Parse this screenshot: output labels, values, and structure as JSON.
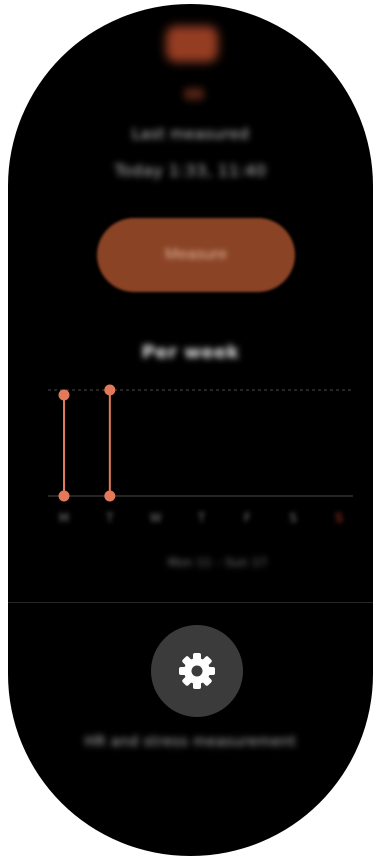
{
  "header": {
    "icon": "heart-rate-icon",
    "last_label": "Last measured",
    "last_time": "Today 1:33, 11:40"
  },
  "measure_button": {
    "label": "Measure"
  },
  "section": {
    "title": "Per week"
  },
  "chart_data": {
    "type": "range-bar",
    "categories": [
      "M",
      "T",
      "W",
      "T",
      "F",
      "S",
      "S"
    ],
    "series": [
      {
        "values": [
          [
            0,
            1.0
          ],
          [
            0,
            1.05
          ],
          null,
          null,
          null,
          null,
          null
        ]
      }
    ],
    "ylim": [
      0,
      1.05
    ],
    "grid": true,
    "accent": "#e2795a",
    "today_index": 6
  },
  "range_label": "Mon 11 – Sun 17",
  "settings": {
    "icon": "gear-icon",
    "label": "HR and stress measurement"
  },
  "colors": {
    "background": "#000000",
    "accent": "#e2795a",
    "button": "#8a4325",
    "settings_button": "#3b3b3b"
  }
}
